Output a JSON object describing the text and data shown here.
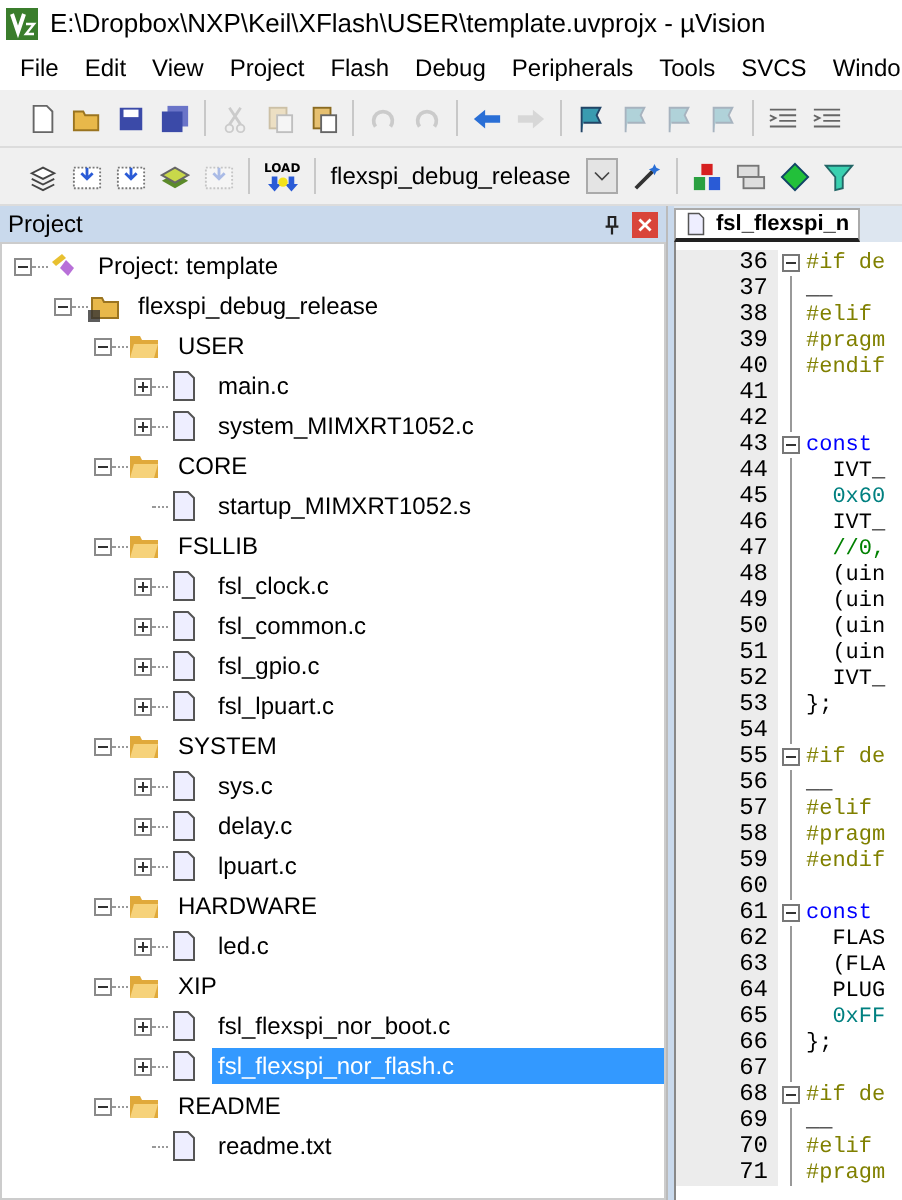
{
  "window": {
    "title": "E:\\Dropbox\\NXP\\Keil\\XFlash\\USER\\template.uvprojx - µVision"
  },
  "menu": [
    "File",
    "Edit",
    "View",
    "Project",
    "Flash",
    "Debug",
    "Peripherals",
    "Tools",
    "SVCS",
    "Windo"
  ],
  "toolbar_1": [
    {
      "kind": "new",
      "disabled": false
    },
    {
      "kind": "open",
      "disabled": false
    },
    {
      "kind": "save",
      "disabled": false
    },
    {
      "kind": "saveall",
      "disabled": false
    },
    {
      "kind": "sep"
    },
    {
      "kind": "cut",
      "disabled": true
    },
    {
      "kind": "copy",
      "disabled": true
    },
    {
      "kind": "paste",
      "disabled": false
    },
    {
      "kind": "sep"
    },
    {
      "kind": "undo",
      "disabled": true
    },
    {
      "kind": "redo",
      "disabled": true
    },
    {
      "kind": "sep"
    },
    {
      "kind": "back",
      "disabled": false
    },
    {
      "kind": "forward",
      "disabled": true
    },
    {
      "kind": "sep"
    },
    {
      "kind": "flag",
      "disabled": false
    },
    {
      "kind": "flagprev",
      "disabled": true
    },
    {
      "kind": "flagnext",
      "disabled": true
    },
    {
      "kind": "flagclear",
      "disabled": true
    },
    {
      "kind": "sep"
    },
    {
      "kind": "indent",
      "disabled": false
    },
    {
      "kind": "indent",
      "disabled": false
    }
  ],
  "toolbar_2": [
    {
      "kind": "translate",
      "disabled": false
    },
    {
      "kind": "build",
      "disabled": false
    },
    {
      "kind": "rebuild",
      "disabled": false
    },
    {
      "kind": "batch",
      "disabled": false
    },
    {
      "kind": "stop",
      "disabled": true
    },
    {
      "kind": "sep"
    },
    {
      "kind": "load",
      "label": "LOAD",
      "disabled": false
    },
    {
      "kind": "sep"
    },
    {
      "kind": "target",
      "value": "flexspi_debug_release"
    },
    {
      "kind": "wand",
      "disabled": false
    },
    {
      "kind": "sep"
    },
    {
      "kind": "components",
      "disabled": false
    },
    {
      "kind": "windows",
      "disabled": false
    },
    {
      "kind": "diamond",
      "disabled": false
    },
    {
      "kind": "funnel",
      "disabled": false
    }
  ],
  "project_panel": {
    "title": "Project",
    "tree": [
      {
        "label": "Project: template",
        "kind": "project",
        "expanded": true,
        "expandable": true,
        "selected": false,
        "children": [
          {
            "label": "flexspi_debug_release",
            "kind": "target",
            "expanded": true,
            "expandable": true,
            "selected": false,
            "children": [
              {
                "label": "USER",
                "kind": "group",
                "expanded": true,
                "expandable": true,
                "selected": false,
                "children": [
                  {
                    "label": "main.c",
                    "kind": "file",
                    "expandable": true,
                    "selected": false
                  },
                  {
                    "label": "system_MIMXRT1052.c",
                    "kind": "file",
                    "expandable": true,
                    "selected": false
                  }
                ]
              },
              {
                "label": "CORE",
                "kind": "group",
                "expanded": true,
                "expandable": true,
                "selected": false,
                "children": [
                  {
                    "label": "startup_MIMXRT1052.s",
                    "kind": "file",
                    "expandable": false,
                    "selected": false
                  }
                ]
              },
              {
                "label": "FSLLIB",
                "kind": "group",
                "expanded": true,
                "expandable": true,
                "selected": false,
                "children": [
                  {
                    "label": "fsl_clock.c",
                    "kind": "file",
                    "expandable": true,
                    "selected": false
                  },
                  {
                    "label": "fsl_common.c",
                    "kind": "file",
                    "expandable": true,
                    "selected": false
                  },
                  {
                    "label": "fsl_gpio.c",
                    "kind": "file",
                    "expandable": true,
                    "selected": false
                  },
                  {
                    "label": "fsl_lpuart.c",
                    "kind": "file",
                    "expandable": true,
                    "selected": false
                  }
                ]
              },
              {
                "label": "SYSTEM",
                "kind": "group",
                "expanded": true,
                "expandable": true,
                "selected": false,
                "children": [
                  {
                    "label": "sys.c",
                    "kind": "file",
                    "expandable": true,
                    "selected": false
                  },
                  {
                    "label": "delay.c",
                    "kind": "file",
                    "expandable": true,
                    "selected": false
                  },
                  {
                    "label": "lpuart.c",
                    "kind": "file",
                    "expandable": true,
                    "selected": false
                  }
                ]
              },
              {
                "label": "HARDWARE",
                "kind": "group",
                "expanded": true,
                "expandable": true,
                "selected": false,
                "children": [
                  {
                    "label": "led.c",
                    "kind": "file",
                    "expandable": true,
                    "selected": false
                  }
                ]
              },
              {
                "label": "XIP",
                "kind": "group",
                "expanded": true,
                "expandable": true,
                "selected": false,
                "children": [
                  {
                    "label": "fsl_flexspi_nor_boot.c",
                    "kind": "file",
                    "expandable": true,
                    "selected": false
                  },
                  {
                    "label": "fsl_flexspi_nor_flash.c",
                    "kind": "file",
                    "expandable": true,
                    "selected": true
                  }
                ]
              },
              {
                "label": "README",
                "kind": "group",
                "expanded": true,
                "expandable": true,
                "selected": false,
                "children": [
                  {
                    "label": "readme.txt",
                    "kind": "file",
                    "expandable": false,
                    "selected": false
                  }
                ]
              }
            ]
          }
        ]
      }
    ]
  },
  "editor": {
    "tab": {
      "label": "fsl_flexspi_n",
      "selected": true
    },
    "lines": [
      {
        "number": "36",
        "text": "#if de",
        "kind": "preproc",
        "fold": true
      },
      {
        "number": "37",
        "text": "__",
        "kind": "plain",
        "fold": false
      },
      {
        "number": "38",
        "text": "#elif",
        "kind": "preproc",
        "fold": false
      },
      {
        "number": "39",
        "text": "#pragm",
        "kind": "preproc",
        "fold": false
      },
      {
        "number": "40",
        "text": "#endif",
        "kind": "preproc",
        "fold": false
      },
      {
        "number": "41",
        "fold": false
      },
      {
        "number": "42",
        "fold": false
      },
      {
        "number": "43",
        "text": "const",
        "kind": "keyword",
        "fold": true
      },
      {
        "number": "44",
        "text": "  IVT_",
        "kind": "plain",
        "fold": false
      },
      {
        "number": "45",
        "text": "  0x60",
        "kind": "number",
        "fold": false
      },
      {
        "number": "46",
        "text": "  IVT_",
        "kind": "plain",
        "fold": false
      },
      {
        "number": "47",
        "text": "  //0,",
        "kind": "comment",
        "fold": false
      },
      {
        "number": "48",
        "text": "  (uin",
        "kind": "plain",
        "fold": false
      },
      {
        "number": "49",
        "text": "  (uin",
        "kind": "plain",
        "fold": false
      },
      {
        "number": "50",
        "text": "  (uin",
        "kind": "plain",
        "fold": false
      },
      {
        "number": "51",
        "text": "  (uin",
        "kind": "plain",
        "fold": false
      },
      {
        "number": "52",
        "text": "  IVT_",
        "kind": "plain",
        "fold": false
      },
      {
        "number": "53",
        "text": "};",
        "kind": "plain",
        "fold": false
      },
      {
        "number": "54",
        "fold": false
      },
      {
        "number": "55",
        "text": "#if de",
        "kind": "preproc",
        "fold": true
      },
      {
        "number": "56",
        "text": "__",
        "kind": "plain",
        "fold": false
      },
      {
        "number": "57",
        "text": "#elif",
        "kind": "preproc",
        "fold": false
      },
      {
        "number": "58",
        "text": "#pragm",
        "kind": "preproc",
        "fold": false
      },
      {
        "number": "59",
        "text": "#endif",
        "kind": "preproc",
        "fold": false
      },
      {
        "number": "60",
        "fold": false
      },
      {
        "number": "61",
        "text": "const",
        "kind": "keyword",
        "fold": true
      },
      {
        "number": "62",
        "text": "  FLAS",
        "kind": "plain",
        "fold": false
      },
      {
        "number": "63",
        "text": "  (FLA",
        "kind": "plain",
        "fold": false
      },
      {
        "number": "64",
        "text": "  PLUG",
        "kind": "plain",
        "fold": false
      },
      {
        "number": "65",
        "text": "  0xFF",
        "kind": "number",
        "fold": false
      },
      {
        "number": "66",
        "text": "};",
        "kind": "plain",
        "fold": false
      },
      {
        "number": "67",
        "fold": false
      },
      {
        "number": "68",
        "text": "#if de",
        "kind": "preproc",
        "fold": true
      },
      {
        "number": "69",
        "text": "__",
        "kind": "plain",
        "fold": false
      },
      {
        "number": "70",
        "text": "#elif",
        "kind": "preproc",
        "fold": false
      },
      {
        "number": "71",
        "text": "#pragm",
        "kind": "preproc",
        "fold": false
      }
    ]
  }
}
